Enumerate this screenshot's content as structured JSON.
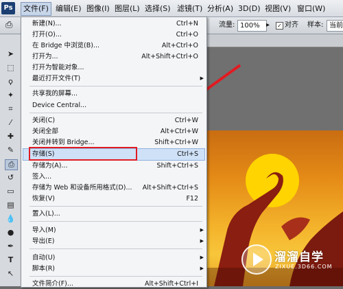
{
  "app": {
    "logo": "Ps"
  },
  "menubar": [
    "文件(F)",
    "编辑(E)",
    "图像(I)",
    "图层(L)",
    "选择(S)",
    "滤镜(T)",
    "分析(A)",
    "3D(D)",
    "视图(V)",
    "窗口(W)"
  ],
  "options_bar": {
    "flow_label": "流量:",
    "flow_value": "100%",
    "align_label": "对齐",
    "sample_label": "样本:",
    "sample_value": "当前图"
  },
  "file_menu": [
    {
      "label": "新建(N)...",
      "shortcut": "Ctrl+N"
    },
    {
      "label": "打开(O)...",
      "shortcut": "Ctrl+O"
    },
    {
      "label": "在 Bridge 中浏览(B)...",
      "shortcut": "Alt+Ctrl+O"
    },
    {
      "label": "打开为...",
      "shortcut": "Alt+Shift+Ctrl+O"
    },
    {
      "label": "打开为智能对象...",
      "shortcut": ""
    },
    {
      "label": "最近打开文件(T)",
      "shortcut": "",
      "submenu": true
    },
    {
      "label": "共享我的屏幕...",
      "shortcut": ""
    },
    {
      "label": "Device Central...",
      "shortcut": ""
    },
    {
      "label": "关闭(C)",
      "shortcut": "Ctrl+W"
    },
    {
      "label": "关闭全部",
      "shortcut": "Alt+Ctrl+W"
    },
    {
      "label": "关闭并转到 Bridge...",
      "shortcut": "Shift+Ctrl+W"
    },
    {
      "label": "存储(S)",
      "shortcut": "Ctrl+S",
      "highlighted": true
    },
    {
      "label": "存储为(A)...",
      "shortcut": "Shift+Ctrl+S"
    },
    {
      "label": "签入...",
      "shortcut": ""
    },
    {
      "label": "存储为 Web 和设备所用格式(D)...",
      "shortcut": "Alt+Shift+Ctrl+S"
    },
    {
      "label": "恢复(V)",
      "shortcut": "F12"
    },
    {
      "label": "置入(L)...",
      "shortcut": ""
    },
    {
      "label": "导入(M)",
      "shortcut": "",
      "submenu": true
    },
    {
      "label": "导出(E)",
      "shortcut": "",
      "submenu": true
    },
    {
      "label": "自动(U)",
      "shortcut": "",
      "submenu": true
    },
    {
      "label": "脚本(R)",
      "shortcut": "",
      "submenu": true
    },
    {
      "label": "文件简介(F)...",
      "shortcut": "Alt+Shift+Ctrl+I"
    }
  ],
  "watermark": {
    "title": "溜溜自学",
    "subtitle": "ZIXUE.3D66.COM"
  },
  "colors": {
    "highlight_box": "#e11b22",
    "arrow": "#e11b22",
    "sun": "#ffd400"
  }
}
